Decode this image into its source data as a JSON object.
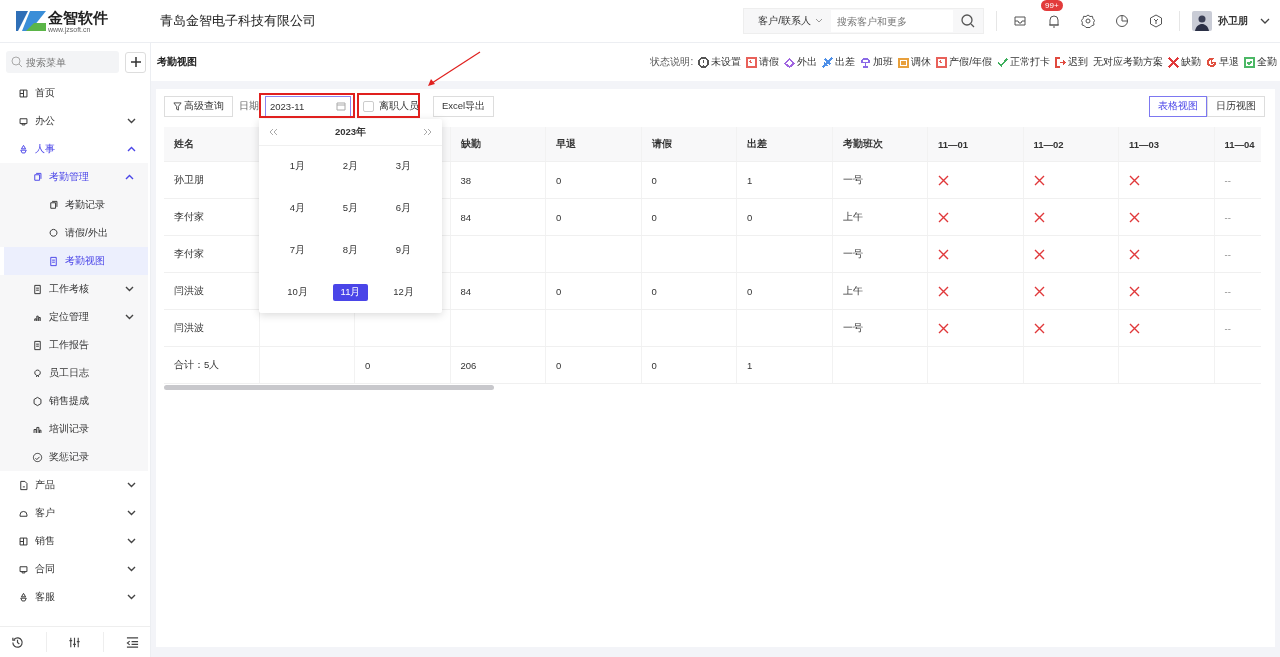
{
  "header": {
    "logo_name": "金智软件",
    "logo_url": "www.jzsoft.cn",
    "company": "青岛金智电子科技有限公司",
    "search_scope": "客户/联系人",
    "search_placeholder": "搜索客户和更多",
    "notification_badge": "99+",
    "user_name": "孙卫朋"
  },
  "sidebar": {
    "search_placeholder": "搜索菜单",
    "items": [
      {
        "label": "首页",
        "selected": false
      },
      {
        "label": "办公",
        "selected": false,
        "expanded": false
      },
      {
        "label": "人事",
        "selected": false,
        "expanded": true,
        "children": [
          {
            "label": "考勤管理",
            "selected": false,
            "expanded": true,
            "children": [
              {
                "label": "考勤记录",
                "selected": false
              },
              {
                "label": "请假/外出",
                "selected": false
              },
              {
                "label": "考勤视图",
                "selected": true
              }
            ]
          },
          {
            "label": "工作考核",
            "selected": false,
            "expanded": false
          },
          {
            "label": "定位管理",
            "selected": false,
            "expanded": false
          },
          {
            "label": "工作报告",
            "selected": false
          },
          {
            "label": "员工日志",
            "selected": false
          },
          {
            "label": "销售提成",
            "selected": false
          },
          {
            "label": "培训记录",
            "selected": false
          },
          {
            "label": "奖惩记录",
            "selected": false
          }
        ]
      },
      {
        "label": "产品",
        "selected": false,
        "expanded": false
      },
      {
        "label": "客户",
        "selected": false,
        "expanded": false
      },
      {
        "label": "销售",
        "selected": false,
        "expanded": false
      },
      {
        "label": "合同",
        "selected": false,
        "expanded": false
      },
      {
        "label": "客服",
        "selected": false,
        "expanded": false
      }
    ]
  },
  "page": {
    "title": "考勤视图",
    "legend_label": "状态说明:",
    "legend": [
      {
        "kind": "info",
        "label": "未设置",
        "color": "#555555"
      },
      {
        "kind": "leave",
        "label": "请假",
        "color": "#e8615a"
      },
      {
        "kind": "outing",
        "label": "外出",
        "color": "#a064e0"
      },
      {
        "kind": "trip",
        "label": "出差",
        "color": "#4d8fe8"
      },
      {
        "kind": "overtime",
        "label": "加班",
        "color": "#8a6ae6"
      },
      {
        "kind": "swap",
        "label": "调休",
        "color": "#e8a03c"
      },
      {
        "kind": "leave",
        "label": "产假/年假",
        "color": "#e8615a"
      },
      {
        "kind": "normal",
        "label": "正常打卡",
        "color": "#3dae5c"
      },
      {
        "kind": "late",
        "label": "迟到",
        "color": "#e04a3f"
      },
      {
        "kind": "none",
        "label": "无对应考勤方案"
      },
      {
        "kind": "absent",
        "label": "缺勤",
        "color": "#e0383a"
      },
      {
        "kind": "early",
        "label": "早退",
        "color": "#e0503f"
      },
      {
        "kind": "full",
        "label": "全勤",
        "color": "#4cb866"
      }
    ]
  },
  "toolbar": {
    "advanced_query": "高级查询",
    "date_label": "日期",
    "date_value": "2023-11",
    "resigned": {
      "label": "离职人员",
      "checked": false
    },
    "export": "Excel导出",
    "views": [
      {
        "label": "表格视图",
        "selected": true
      },
      {
        "label": "日历视图",
        "selected": false
      }
    ]
  },
  "month_picker": {
    "year": "2023年",
    "months": [
      {
        "label": "1月",
        "selected": false
      },
      {
        "label": "2月",
        "selected": false
      },
      {
        "label": "3月",
        "selected": false
      },
      {
        "label": "4月",
        "selected": false
      },
      {
        "label": "5月",
        "selected": false
      },
      {
        "label": "6月",
        "selected": false
      },
      {
        "label": "7月",
        "selected": false
      },
      {
        "label": "8月",
        "selected": false
      },
      {
        "label": "9月",
        "selected": false
      },
      {
        "label": "10月",
        "selected": false
      },
      {
        "label": "11月",
        "selected": true
      },
      {
        "label": "12月",
        "selected": false
      }
    ]
  },
  "table": {
    "columns": [
      "姓名",
      null,
      null,
      "缺勤",
      "早退",
      "请假",
      "出差",
      "考勤班次",
      "11—01",
      "11—02",
      "11—03",
      "11—04"
    ],
    "rows": [
      {
        "cells": [
          "孙卫朋",
          null,
          null,
          "38",
          "0",
          "0",
          "1",
          "一号"
        ],
        "days": [
          {
            "kind": "absent"
          },
          {
            "kind": "absent"
          },
          {
            "kind": "absent"
          },
          {
            "kind": "empty",
            "text": "--"
          }
        ]
      },
      {
        "cells": [
          "李付家",
          null,
          null,
          "84",
          "0",
          "0",
          "0",
          "上午"
        ],
        "days": [
          {
            "kind": "absent"
          },
          {
            "kind": "absent"
          },
          {
            "kind": "absent"
          },
          {
            "kind": "empty",
            "text": "--"
          }
        ]
      },
      {
        "cells": [
          "李付家",
          null,
          null,
          null,
          null,
          null,
          null,
          "一号"
        ],
        "days": [
          {
            "kind": "absent"
          },
          {
            "kind": "absent"
          },
          {
            "kind": "absent"
          },
          {
            "kind": "empty",
            "text": "--"
          }
        ]
      },
      {
        "cells": [
          "闫洪波",
          null,
          null,
          "84",
          "0",
          "0",
          "0",
          "上午"
        ],
        "days": [
          {
            "kind": "absent"
          },
          {
            "kind": "absent"
          },
          {
            "kind": "absent"
          },
          {
            "kind": "empty",
            "text": "--"
          }
        ]
      },
      {
        "cells": [
          "闫洪波",
          null,
          null,
          null,
          null,
          null,
          null,
          "一号"
        ],
        "days": [
          {
            "kind": "absent"
          },
          {
            "kind": "absent"
          },
          {
            "kind": "absent"
          },
          {
            "kind": "empty",
            "text": "--"
          }
        ]
      },
      {
        "cells": [
          "合计：5人",
          null,
          "0",
          "206",
          "0",
          "0",
          "1",
          null
        ]
      }
    ]
  }
}
